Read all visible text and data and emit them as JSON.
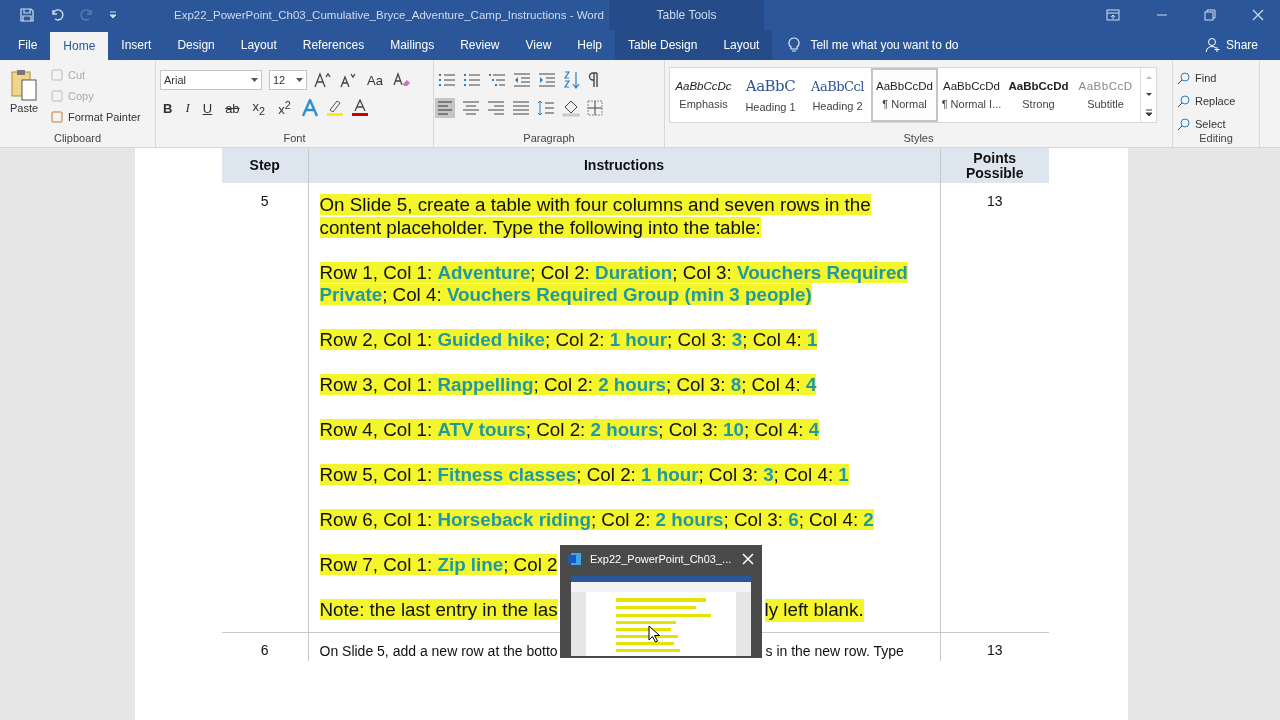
{
  "title_bar": {
    "title": "Exp22_PowerPoint_Ch03_Cumulative_Bryce_Adventure_Camp_Instructions  -  Word",
    "context": "Table Tools"
  },
  "tabs": [
    {
      "label": "File",
      "selected": false
    },
    {
      "label": "Home",
      "selected": true
    },
    {
      "label": "Insert",
      "selected": false
    },
    {
      "label": "Design",
      "selected": false
    },
    {
      "label": "Layout",
      "selected": false
    },
    {
      "label": "References",
      "selected": false
    },
    {
      "label": "Mailings",
      "selected": false
    },
    {
      "label": "Review",
      "selected": false
    },
    {
      "label": "View",
      "selected": false
    },
    {
      "label": "Help",
      "selected": false
    },
    {
      "label": "Table Design",
      "selected": false
    },
    {
      "label": "Layout",
      "selected": false
    }
  ],
  "tell_me": "Tell me what you want to do",
  "share": "Share",
  "clipboard": {
    "paste": "Paste",
    "items": [
      {
        "label": "Cut",
        "disabled": true
      },
      {
        "label": "Copy",
        "disabled": true
      },
      {
        "label": "Format Painter",
        "disabled": false
      }
    ],
    "group": "Clipboard"
  },
  "font": {
    "name": "Arial",
    "size": "12",
    "case_button": "Aa",
    "format_buttons": [
      "B",
      "I",
      "U",
      "ab",
      "x$_{2}$",
      "x$^{2}$"
    ],
    "group": "Font"
  },
  "paragraph": {
    "group": "Paragraph"
  },
  "styles": {
    "items": [
      {
        "preview": "AaBbCcDc",
        "name": "Emphasis",
        "kind": "emphasis",
        "selected": false
      },
      {
        "preview": "AaBbC",
        "name": "Heading 1",
        "kind": "heading1",
        "selected": false
      },
      {
        "preview": "AaBbCcl",
        "name": "Heading 2",
        "kind": "heading2",
        "selected": false
      },
      {
        "preview": "AaBbCcDd",
        "name": "¶ Normal",
        "kind": "normal",
        "selected": true
      },
      {
        "preview": "AaBbCcDd",
        "name": "¶ Normal I...",
        "kind": "normal",
        "selected": false
      },
      {
        "preview": "AaBbCcDd",
        "name": "Strong",
        "kind": "strong",
        "selected": false
      },
      {
        "preview": "AaBbCcD",
        "name": "Subtitle",
        "kind": "subtitle",
        "selected": false
      }
    ],
    "group": "Styles"
  },
  "editing": {
    "items": [
      "Find",
      "Replace",
      "Select"
    ],
    "group": "Editing"
  },
  "table": {
    "columns": [
      "Step",
      "Instructions",
      "Points Possible"
    ],
    "rows": [
      {
        "step": "5",
        "points": "13",
        "paragraphs": [
          {
            "parts": [
              "On Slide 5, create a table with four columns and seven rows in the content placeholder. Type the following into the table:"
            ],
            "highlight": true
          },
          {
            "parts": [
              "Row 1, Col 1: **Adventure**; Col 2: **Duration**; Col 3: **Vouchers Required Private**; Col 4: **Vouchers Required Group (min 3 people)**"
            ],
            "highlight": true
          },
          {
            "parts": [
              "Row 2, Col 1: **Guided hike**; Col 2: **1 hour**; Col 3: **3**; Col 4: **1**"
            ],
            "highlight": true
          },
          {
            "parts": [
              "Row 3, Col 1: **Rappelling**; Col 2: **2 hours**; Col 3: **8**; Col 4: **4**"
            ],
            "highlight": true
          },
          {
            "parts": [
              "Row 4, Col 1: **ATV tours**; Col 2: **2 hours**; Col 3: **10**; Col 4: **4**"
            ],
            "highlight": true
          },
          {
            "parts": [
              "Row 5, Col 1: **Fitness classes**; Col 2: **1 hour**; Col 3: **3**; Col 4: **1**"
            ],
            "highlight": true
          },
          {
            "parts": [
              "Row 6, Col 1: **Horseback riding**; Col 2: **2 hours**; Col 3: **6**; Col 4: **2**"
            ],
            "highlight": true
          },
          {
            "parts": [
              "Row 7, Col 1: **Zip line**; Col 2"
            ],
            "highlight": true
          },
          {
            "parts": [
              "Note: the last entry in the las",
              "ly left blank."
            ],
            "highlight": true
          }
        ]
      },
      {
        "step": "6",
        "points": "13",
        "paragraphs": [
          {
            "parts": [
              "On Slide 5, add a new row at the botto",
              "s in the new row. Type"
            ],
            "highlight": false
          }
        ]
      }
    ]
  },
  "thumbnail_popup": {
    "title": "Exp22_PowerPoint_Ch03_..."
  }
}
